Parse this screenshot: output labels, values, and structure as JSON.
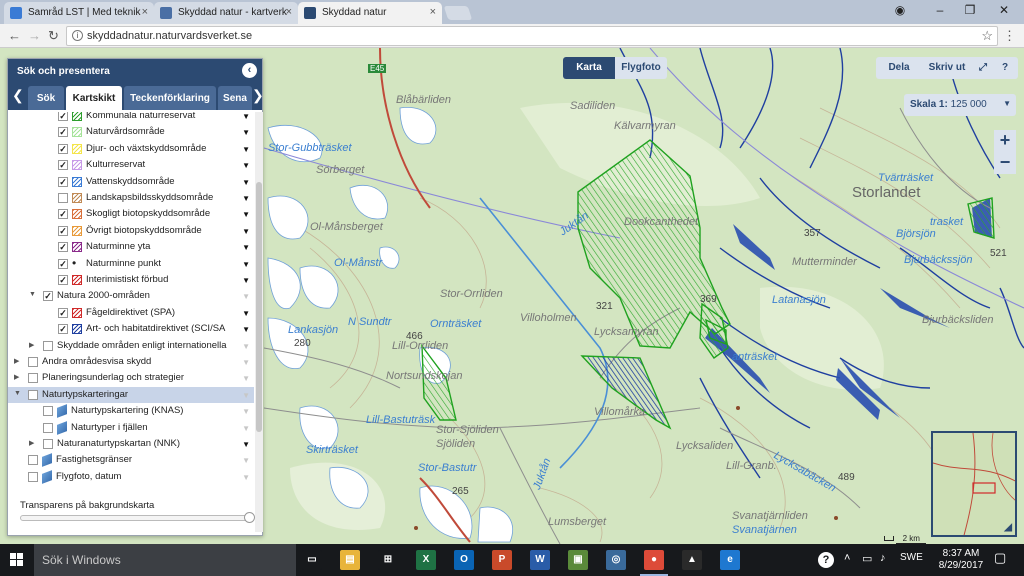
{
  "browser": {
    "tabs": [
      {
        "title": "Samråd LST | Med teknik",
        "icon_color": "#3a7bd5"
      },
      {
        "title": "Skyddad natur - kartverk",
        "icon_color": "#4a6fa5"
      },
      {
        "title": "Skyddad natur",
        "icon_color": "#2c4a72"
      }
    ],
    "close_glyph": "×",
    "url": "skyddadnatur.naturvardsverket.se"
  },
  "panel": {
    "title": "Sök och presentera",
    "tabs": [
      "Sök",
      "Kartskikt",
      "Teckenförklaring",
      "Sena"
    ],
    "active_tab": "Kartskikt",
    "layers": [
      {
        "label": "Kommunala naturreservat",
        "checked": true,
        "indent": 2,
        "symbol": "#2e9e2e",
        "active": true
      },
      {
        "label": "Naturvårdsområde",
        "checked": true,
        "indent": 2,
        "symbol": "#a6e39a",
        "active": true
      },
      {
        "label": "Djur- och växtskyddsområde",
        "checked": true,
        "indent": 2,
        "symbol": "#f4e54a",
        "active": true
      },
      {
        "label": "Kulturreservat",
        "checked": true,
        "indent": 2,
        "symbol": "#c89ae8",
        "active": true
      },
      {
        "label": "Vattenskyddsområde",
        "checked": true,
        "indent": 2,
        "symbol": "#3a7bd5",
        "active": true
      },
      {
        "label": "Landskapsbildsskyddsområde",
        "checked": false,
        "indent": 2,
        "symbol": "#c08a55",
        "active": true
      },
      {
        "label": "Skogligt biotopskyddsområde",
        "checked": true,
        "indent": 2,
        "symbol": "#d86f3a",
        "active": true
      },
      {
        "label": "Övrigt biotopskyddsområde",
        "checked": true,
        "indent": 2,
        "symbol": "#e89a3a",
        "active": true
      },
      {
        "label": "Naturminne yta",
        "checked": true,
        "indent": 2,
        "symbol": "#8a2a8a",
        "active": true
      },
      {
        "label": "Naturminne punkt",
        "checked": true,
        "indent": 2,
        "symbol": "dot",
        "active": true
      },
      {
        "label": "Interimistiskt förbud",
        "checked": true,
        "indent": 2,
        "symbol": "#d02a2a",
        "active": true
      },
      {
        "label": "Natura 2000-områden",
        "checked": true,
        "indent": 1,
        "expander": "▼",
        "active": false
      },
      {
        "label": "Fågeldirektivet (SPA)",
        "checked": true,
        "indent": 2,
        "symbol": "#d02a2a",
        "active": true
      },
      {
        "label": "Art- och habitatdirektivet (SCI/SA",
        "checked": true,
        "indent": 2,
        "symbol": "#1f3fa0",
        "active": true
      },
      {
        "label": "Skyddade områden enligt internationella",
        "checked": false,
        "indent": 1,
        "expander": "▶",
        "active": false
      },
      {
        "label": "Andra områdesvisa skydd",
        "checked": false,
        "indent": 0,
        "expander": "▶",
        "active": false
      },
      {
        "label": "Planeringsunderlag och strategier",
        "checked": false,
        "indent": 0,
        "expander": "▶",
        "active": false
      },
      {
        "label": "Naturtypskarteringar",
        "checked": false,
        "indent": 0,
        "expander": "▼",
        "active": false,
        "selected": true
      },
      {
        "label": "Naturtypskartering (KNAS)",
        "checked": false,
        "indent": 1,
        "symbol": "stack",
        "active": false
      },
      {
        "label": "Naturtyper i fjällen",
        "checked": false,
        "indent": 1,
        "symbol": "stack",
        "active": false
      },
      {
        "label": "Naturanaturtypskartan (NNK)",
        "checked": false,
        "indent": 1,
        "expander": "▶",
        "active": true
      },
      {
        "label": "Fastighetsgränser",
        "checked": false,
        "indent": 0,
        "symbol": "stack",
        "active": false
      },
      {
        "label": "Flygfoto, datum",
        "checked": false,
        "indent": 0,
        "symbol": "stack",
        "active": false
      }
    ],
    "transparency_label": "Transparens på bakgrundskarta",
    "transparency": 1.0
  },
  "map": {
    "view_buttons": [
      "Karta",
      "Flygfoto"
    ],
    "active_view": "Karta",
    "action_buttons": [
      "Dela",
      "Skriv ut"
    ],
    "scale_label": "Skala 1:",
    "scale_value": "125 000",
    "zoom_in": "+",
    "zoom_out": "−",
    "scalebar": "2 km",
    "place_names": {
      "storlandet": "Storlandet",
      "sadiliden": "Sadiliden",
      "kalvarmyran": "Kälvarmyran",
      "blabarliden": "Blåbärliden",
      "storgubbtrasket": "Stor-Gubbträsket",
      "sorberget": "Sörberget",
      "omansberget": "Ol-Månsberget",
      "olmanstr": "Ol-Månstr",
      "lankasjon": "Lankasjön",
      "nsundtr": "N Sundtr",
      "stororrliden": "Stor-Orrliden",
      "villoholmen": "Villoholmen",
      "lycksamyran": "Lycksamyran",
      "lillorrliden": "Lill-Orrliden",
      "nortsundskojan": "Nortsundskojan",
      "ornrasket": "Ornträsket",
      "lillbastutrask": "Lill-Bastuträsk",
      "storsjoliden": "Stor-Sjöliden",
      "sjoliden": "Sjöliden",
      "skirtrasket": "Skirträsket",
      "storbastutr": "Stor-Bastutr",
      "villomarka": "Villomårka",
      "lycksaliden": "Lycksaliden",
      "lillgranb": "Lill-Granb.",
      "lumsberget": "Lumsberget",
      "svanatjarnliden": "Svanatjärnliden",
      "svanatjarnen": "Svanatjärnen",
      "lycksabacken": "Lycksabäcken",
      "tvaratrasket": "Tvärträsket",
      "trasket": "trasket",
      "latanasjon": "Latanasjön",
      "bjurbacksliden": "Bjurbäcksliden",
      "bjurbackssjon": "Bjurbäckssjön",
      "antrasket": "anträsket",
      "mutterminder": "Mutterminder",
      "dookcanthedet": "Dookcanthedet",
      "juktan": "Juktån",
      "juktan2": "Juktån",
      "bjorsjon": "Björsjön"
    },
    "road_label": "E45",
    "elevations": [
      "357",
      "369",
      "321",
      "466",
      "280",
      "265",
      "521",
      "489",
      "321"
    ]
  },
  "taskbar": {
    "search_placeholder": "Sök i Windows",
    "apps": [
      {
        "name": "task-view",
        "color": "#17191c",
        "glyph": "▭"
      },
      {
        "name": "file-explorer",
        "color": "#e8b43a",
        "glyph": "▤"
      },
      {
        "name": "store",
        "color": "#17191c",
        "glyph": "⊞"
      },
      {
        "name": "excel",
        "color": "#1f7244",
        "glyph": "X"
      },
      {
        "name": "outlook",
        "color": "#0a64b4",
        "glyph": "O"
      },
      {
        "name": "powerpoint",
        "color": "#c94a2a",
        "glyph": "P"
      },
      {
        "name": "word",
        "color": "#2a5ca8",
        "glyph": "W"
      },
      {
        "name": "installer",
        "color": "#5a8a3a",
        "glyph": "▣"
      },
      {
        "name": "magnifier",
        "color": "#3a6a9a",
        "glyph": "◎"
      },
      {
        "name": "chrome",
        "color": "#dd4b39",
        "glyph": "●"
      },
      {
        "name": "photos",
        "color": "#2a2a2a",
        "glyph": "▲"
      },
      {
        "name": "edge",
        "color": "#1e78d0",
        "glyph": "e"
      }
    ],
    "tray_help": "?",
    "language": "SWE",
    "time": "8:37 AM",
    "date": "8/29/2017"
  }
}
